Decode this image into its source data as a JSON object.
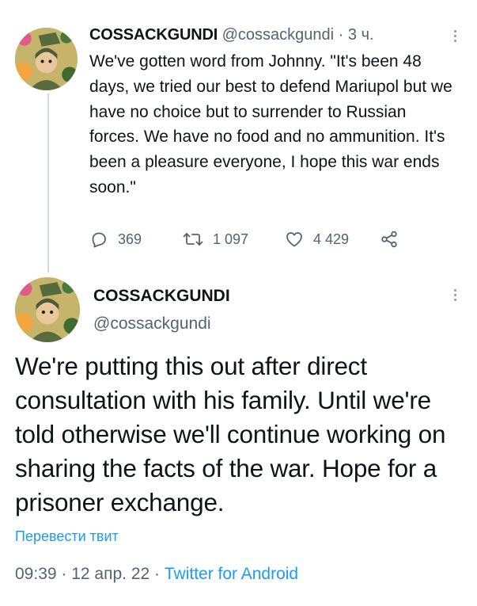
{
  "tweet1": {
    "display_name": "COSSACKGUNDI",
    "handle": "@cossackgundi",
    "separator": "·",
    "time": "3 ч.",
    "text": "We've gotten word from Johnny. \"It's been 48 days, we tried our best to defend Mariupol but we have no choice but to surrender to Russian forces. We have no food and no ammunition. It's been a pleasure everyone, I hope this war ends soon.\"",
    "reply_count": "369",
    "retweet_count": "1 097",
    "like_count": "4 429"
  },
  "tweet2": {
    "display_name": "COSSACKGUNDI",
    "handle": "@cossackgundi",
    "text": "We're putting this out after direct consultation with his family. Until we're told otherwise we'll continue working on sharing the facts of the war. Hope for a prisoner exchange.",
    "translate_label": "Перевести твит",
    "time": "09:39",
    "separator1": " · ",
    "date": "12 апр. 22",
    "separator2": " · ",
    "source": "Twitter for Android"
  },
  "icons": {
    "reply": "reply-icon",
    "retweet": "retweet-icon",
    "like": "heart-icon",
    "share": "share-icon",
    "more": "more-vertical-icon"
  },
  "colors": {
    "text": "#0f1419",
    "secondary": "#536471",
    "link": "#1d9bf0",
    "thread_line": "#cfd9de"
  }
}
